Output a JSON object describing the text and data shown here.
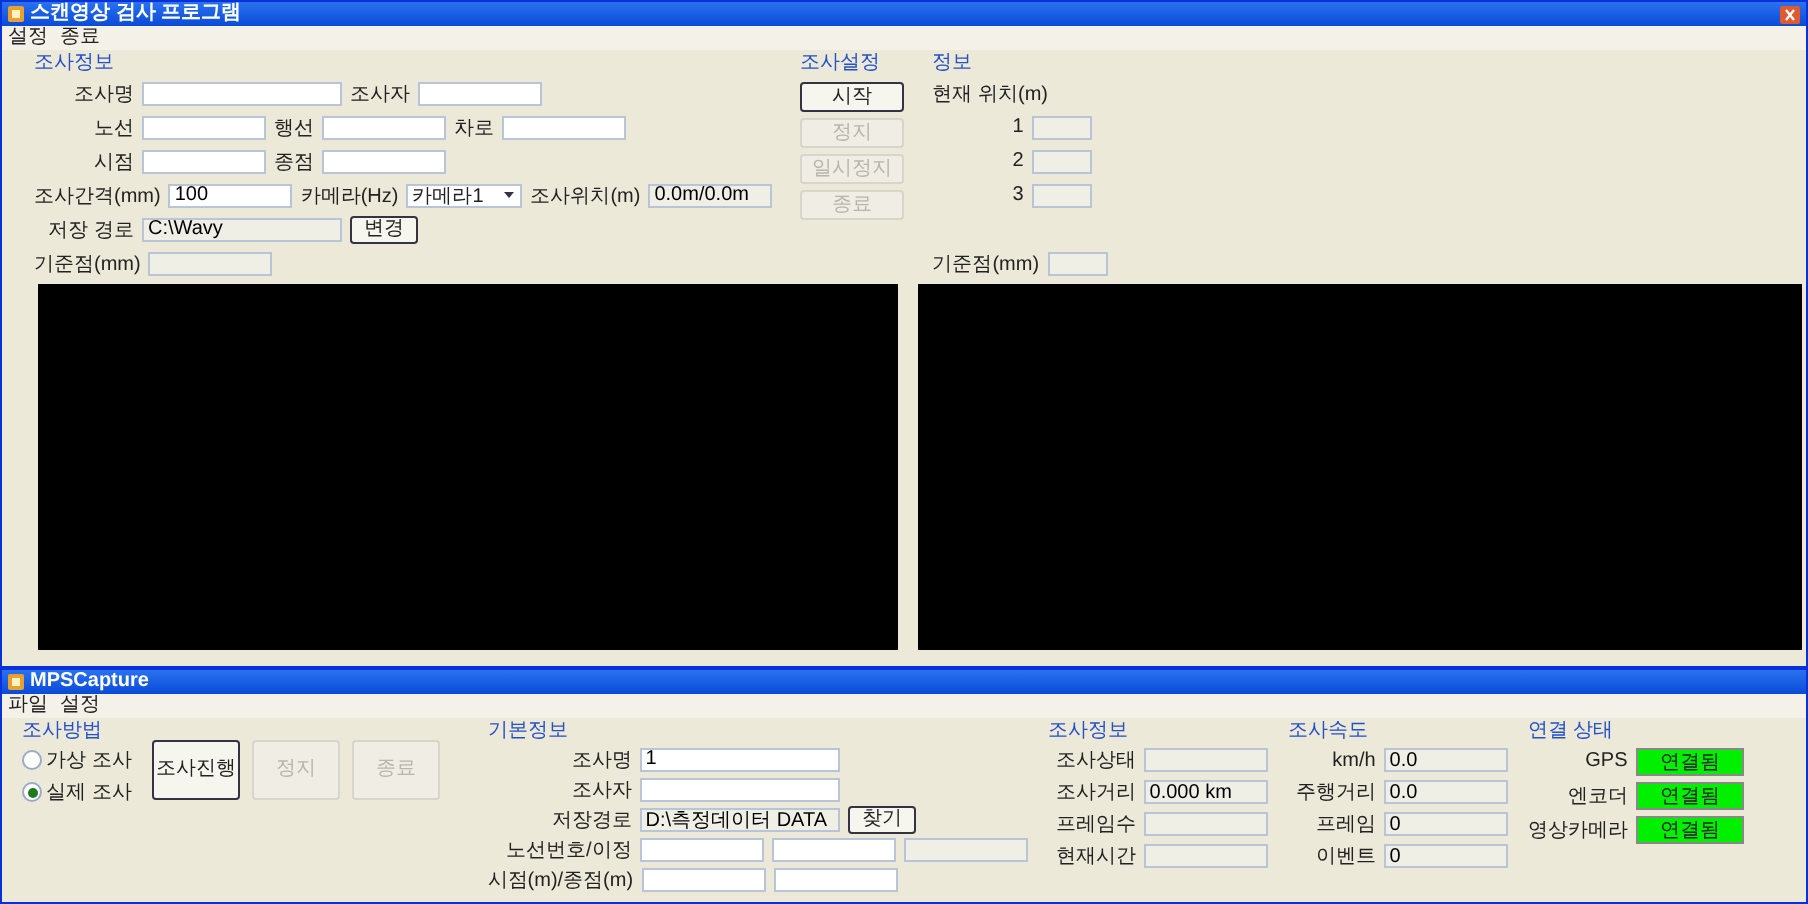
{
  "main_window": {
    "title": "스캔영상 검사 프로그램",
    "menu": [
      "설정",
      "종료"
    ],
    "survey_info": {
      "title": "조사정보",
      "rows": [
        [
          {
            "kind": "long_input",
            "label": "조사명"
          },
          {
            "kind": "input",
            "label": "조사자"
          }
        ],
        [
          {
            "kind": "input",
            "label": "노선"
          },
          {
            "kind": "input",
            "label": "행선"
          },
          {
            "kind": "input",
            "label": "차로"
          }
        ],
        [
          {
            "kind": "input",
            "label": "시점"
          },
          {
            "kind": "input",
            "label": "종점"
          }
        ],
        [
          {
            "kind": "input",
            "label": "조사간격(mm)",
            "value": "100"
          },
          {
            "kind": "select",
            "label": "카메라(Hz)",
            "value": "카메라1"
          },
          {
            "kind": "readonly",
            "label": "조사위치(m)",
            "value": "0.0m/0.0m"
          }
        ],
        [
          {
            "kind": "long_readonly",
            "label": "저장 경로",
            "value": "C:\\Wavy"
          },
          {
            "kind": "button",
            "label": "변경"
          }
        ]
      ]
    },
    "control": {
      "title": "조사설정",
      "buttons": [
        {
          "label": "시작",
          "disabled": false
        },
        {
          "label": "정지",
          "disabled": true
        },
        {
          "label": "일시정지",
          "disabled": true
        },
        {
          "label": "종료",
          "disabled": true
        }
      ]
    },
    "info": {
      "title": "정보",
      "label": "현재 위치(m)",
      "readouts": [
        "1",
        "2",
        "3"
      ]
    },
    "reference_left": "기준점(mm)",
    "reference_right": "기준점(mm)"
  },
  "capture_window": {
    "title": "MPSCapture",
    "menu": [
      "파일",
      "설정"
    ],
    "method": {
      "title": "조사방법",
      "options": [
        {
          "label": "가상 조사",
          "selected": false
        },
        {
          "label": "실제 조사",
          "selected": true
        }
      ]
    },
    "buttons": [
      {
        "label": "조사진행",
        "disabled": false
      },
      {
        "label": "정지",
        "disabled": true
      },
      {
        "label": "종료",
        "disabled": true
      }
    ],
    "basic_info": {
      "title": "기본정보",
      "rows": [
        [
          {
            "kind": "long_input",
            "label": "조사명",
            "value": "1"
          }
        ],
        [
          {
            "kind": "long_input",
            "label": "조사자"
          }
        ],
        [
          {
            "kind": "long_readonly",
            "label": "저장경로",
            "value": "D:\\측정데이터 DATA"
          },
          {
            "kind": "button",
            "label": "찾기"
          }
        ],
        [
          {
            "kind": "input",
            "label": "노선번호/이정"
          },
          {
            "kind": "input"
          },
          {
            "kind": "readonly"
          }
        ],
        [
          {
            "kind": "input",
            "label": "시점(m)/종점(m)"
          },
          {
            "kind": "input"
          }
        ]
      ]
    },
    "status": {
      "title": "조사정보",
      "rows": [
        {
          "label": "조사상태"
        },
        {
          "label": "조사거리",
          "value": "0.000 km"
        },
        {
          "label": "프레임수"
        },
        {
          "label": "현재시간"
        }
      ]
    },
    "speed": {
      "title": "조사속도",
      "rows": [
        {
          "label": "km/h",
          "value": "0.0"
        },
        {
          "label": "주행거리",
          "value": "0.0"
        },
        {
          "label": "프레임",
          "value": "0"
        },
        {
          "label": "이벤트",
          "value": "0"
        }
      ]
    },
    "connection": {
      "title": "연결 상태",
      "items": [
        {
          "label": "GPS",
          "status": "연결됨",
          "connected": true
        },
        {
          "label": "엔코더",
          "status": "연결됨",
          "connected": true
        },
        {
          "label": "영상카메라",
          "status": "연결됨",
          "connected": true
        }
      ]
    }
  }
}
